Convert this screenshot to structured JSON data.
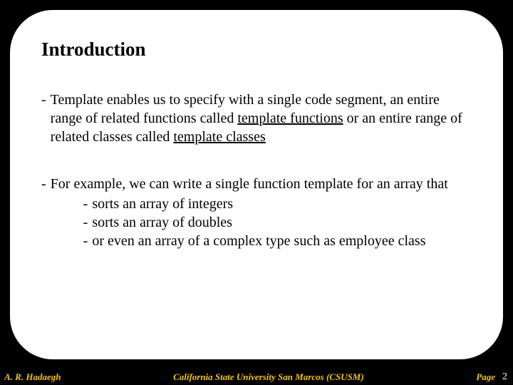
{
  "title": "Introduction",
  "para1": {
    "pre": "Template enables us to specify with a single code segment, an entire range of related functions called ",
    "u1": "template functions",
    "mid": " or an entire range of related classes called ",
    "u2": "template classes"
  },
  "para2_lead": "For example, we can write a single function template for an array that",
  "sub1": "sorts an array of integers",
  "sub2": "sorts an array of doubles",
  "sub3": "or even an array of a complex type such as employee class",
  "footer": {
    "name": "A. R. Hadaegh",
    "school": "California State University San Marcos (CSUSM)",
    "page_label": "Page",
    "page_number": "2"
  }
}
